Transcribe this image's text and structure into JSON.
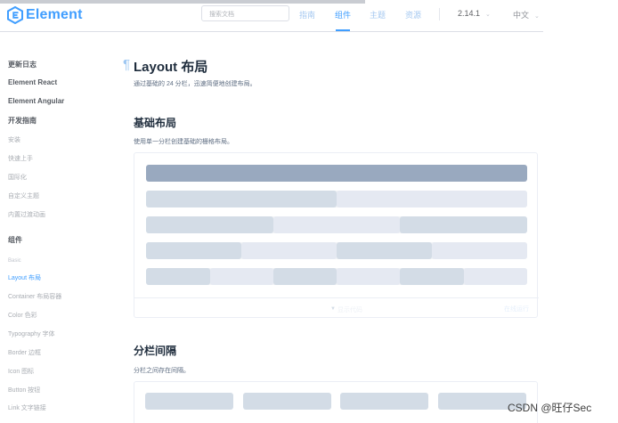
{
  "header": {
    "logo_text": "Element",
    "search_placeholder": "搜索文档",
    "nav": [
      "指南",
      "组件",
      "主题",
      "资源"
    ],
    "active_nav": "组件",
    "version": "2.14.1",
    "language": "中文",
    "caret": "⌄"
  },
  "sidebar": {
    "items": [
      "更新日志",
      "Element React",
      "Element Angular",
      "开发指南",
      "安装",
      "快速上手",
      "国际化",
      "自定义主题",
      "内置过渡动画",
      "组件",
      "Basic",
      "Layout 布局",
      "Container 布局容器",
      "Color 色彩",
      "Typography 字体",
      "Border 边框",
      "Icon 图标",
      "Button 按钮",
      "Link 文字链接"
    ],
    "active_item": "Layout 布局"
  },
  "main": {
    "anchor": "¶",
    "title": "Layout 布局",
    "description": "通过基础的 24 分栏，迅速简便地创建布局。",
    "sections": [
      {
        "title": "基础布局",
        "description": "使用单一分栏创建基础的栅格布局。"
      },
      {
        "title": "分栏间隔",
        "description": "分栏之间存在间隔。"
      }
    ],
    "demo_footer": {
      "arrow": "▼",
      "expand_label": "显示代码",
      "run_label": "在线运行"
    }
  },
  "colors": {
    "accent": "#409eff",
    "grid_dark": "#99a9bf",
    "grid_mid": "#d3dce6",
    "grid_light": "#e5e9f2",
    "row_bg": "#f0f2f5"
  },
  "icons": {
    "logo": "element-logo-icon",
    "caret": "chevron-down-icon",
    "expand": "caret-down-icon"
  },
  "watermark": "CSDN @旺仔Sec"
}
